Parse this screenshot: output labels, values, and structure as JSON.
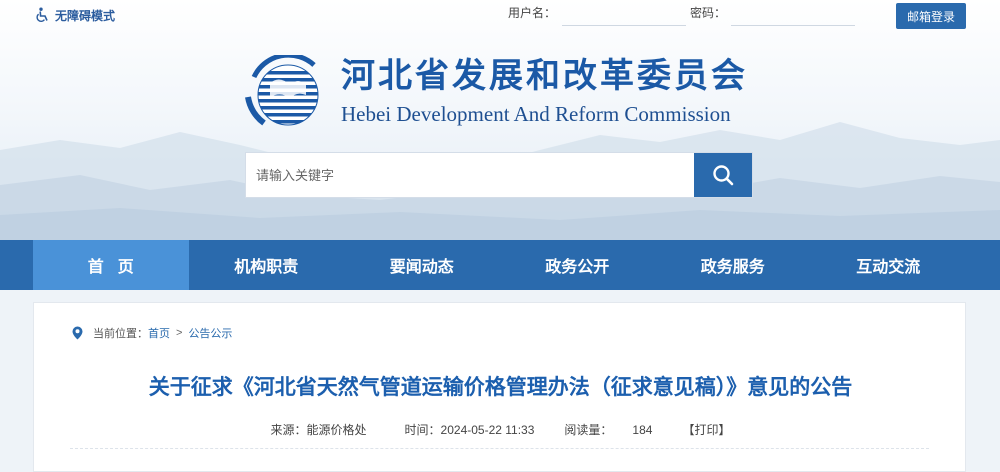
{
  "top_bar": {
    "accessibility_label": "无障碍模式",
    "username_label": "用户名：",
    "username_value": "",
    "password_label": "密码：",
    "password_value": "",
    "mail_login_label": "邮箱登录"
  },
  "header": {
    "title": "河北省发展和改革委员会",
    "subtitle": "Hebei Development And Reform Commission"
  },
  "search": {
    "placeholder": "请输入关键字",
    "value": ""
  },
  "nav": {
    "items": [
      {
        "label": "首页",
        "active": true
      },
      {
        "label": "机构职责",
        "active": false
      },
      {
        "label": "要闻动态",
        "active": false
      },
      {
        "label": "政务公开",
        "active": false
      },
      {
        "label": "政务服务",
        "active": false
      },
      {
        "label": "互动交流",
        "active": false
      }
    ]
  },
  "breadcrumb": {
    "prefix": "当前位置：",
    "home": "首页",
    "separator": ">",
    "current": "公告公示"
  },
  "article": {
    "title": "关于征求《河北省天然气管道运输价格管理办法（征求意见稿）》意见的公告",
    "source_label": "来源：",
    "source_value": "能源价格处",
    "time_label": "时间：",
    "time_value": "2024-05-22 11:33",
    "views_label": "阅读量：",
    "views_value": "184",
    "print_label": "打印",
    "bracket_open": "【",
    "bracket_close": "】"
  },
  "colors": {
    "primary": "#2a6aad",
    "nav_active": "#4a92d8",
    "title_blue": "#1b59a6"
  },
  "icons": [
    "wheelchair-icon",
    "emblem-logo",
    "search-icon",
    "location-pin-icon"
  ]
}
